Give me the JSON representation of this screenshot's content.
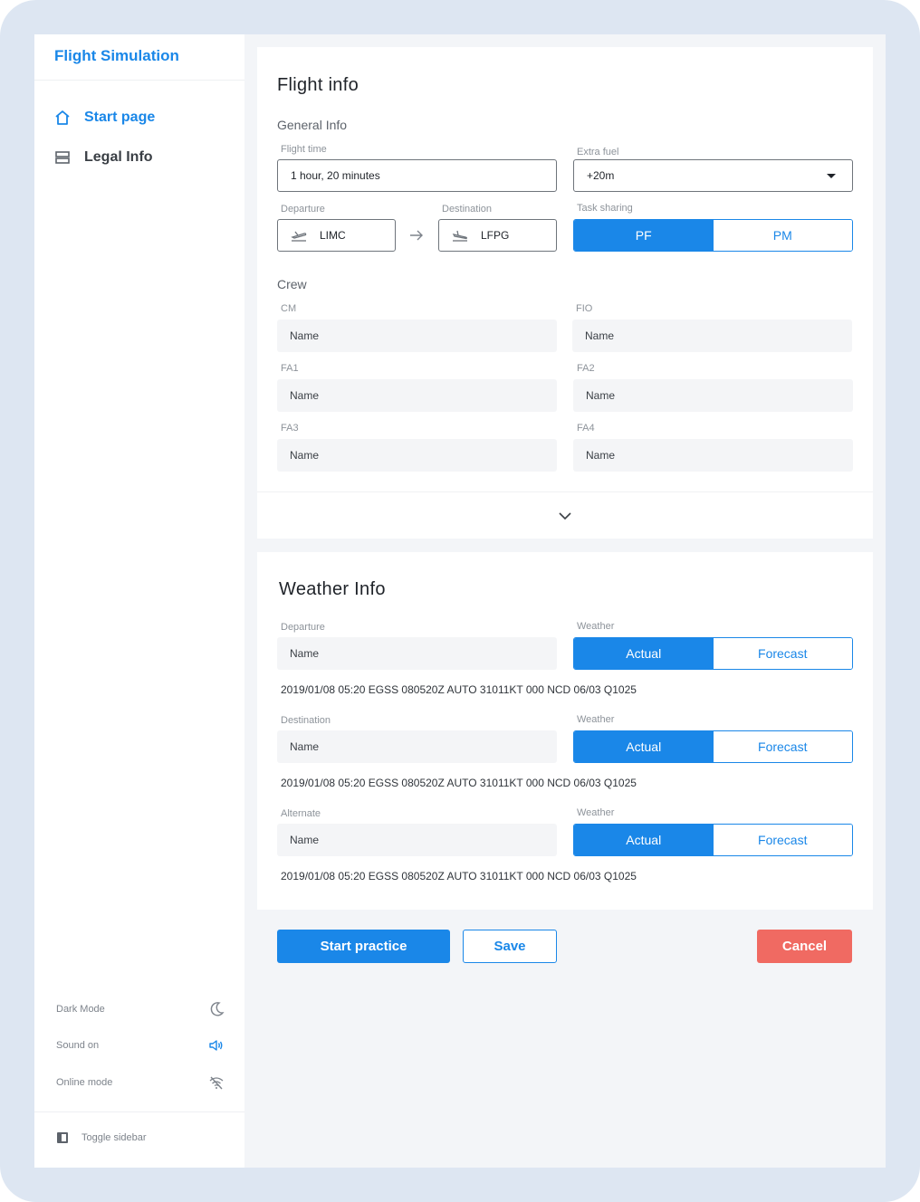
{
  "app": {
    "title": "Flight Simulation"
  },
  "sidebar": {
    "items": [
      {
        "label": "Start page",
        "icon": "home-icon",
        "active": true
      },
      {
        "label": "Legal Info",
        "icon": "layers-icon",
        "active": false
      }
    ],
    "settings": [
      {
        "label": "Dark Mode",
        "icon": "moon-icon"
      },
      {
        "label": "Sound on",
        "icon": "speaker-icon"
      },
      {
        "label": "Online mode",
        "icon": "wifi-off-icon"
      }
    ],
    "toggle_label": "Toggle sidebar"
  },
  "flight_info": {
    "title": "Flight info",
    "general_label": "General Info",
    "flight_time": {
      "label": "Flight time",
      "value": "1 hour, 20 minutes"
    },
    "extra_fuel": {
      "label": "Extra fuel",
      "value": "+20m"
    },
    "departure": {
      "label": "Departure",
      "value": "LIMC"
    },
    "destination": {
      "label": "Destination",
      "value": "LFPG"
    },
    "task_sharing": {
      "label": "Task sharing",
      "options": [
        "PF",
        "PM"
      ],
      "selected": "PF"
    },
    "crew_label": "Crew",
    "crew": [
      {
        "label": "CM",
        "placeholder": "Name"
      },
      {
        "label": "FIO",
        "placeholder": "Name"
      },
      {
        "label": "FA1",
        "placeholder": "Name"
      },
      {
        "label": "FA2",
        "placeholder": "Name"
      },
      {
        "label": "FA3",
        "placeholder": "Name"
      },
      {
        "label": "FA4",
        "placeholder": "Name"
      }
    ]
  },
  "weather_info": {
    "title": "Weather Info",
    "rows": [
      {
        "label": "Departure",
        "placeholder": "Name",
        "weather_label": "Weather",
        "options": [
          "Actual",
          "Forecast"
        ],
        "selected": "Actual",
        "metar": "2019/01/08 05:20 EGSS 080520Z AUTO 31011KT 000 NCD 06/03 Q1025"
      },
      {
        "label": "Destination",
        "placeholder": "Name",
        "weather_label": "Weather",
        "options": [
          "Actual",
          "Forecast"
        ],
        "selected": "Actual",
        "metar": "2019/01/08 05:20 EGSS 080520Z AUTO 31011KT 000 NCD 06/03 Q1025"
      },
      {
        "label": "Alternate",
        "placeholder": "Name",
        "weather_label": "Weather",
        "options": [
          "Actual",
          "Forecast"
        ],
        "selected": "Actual",
        "metar": "2019/01/08 05:20 EGSS 080520Z AUTO 31011KT 000 NCD 06/03 Q1025"
      }
    ]
  },
  "actions": {
    "start": "Start practice",
    "save": "Save",
    "cancel": "Cancel"
  },
  "colors": {
    "accent": "#1a87e8",
    "danger": "#f06a62",
    "background": "#f3f5f8"
  }
}
